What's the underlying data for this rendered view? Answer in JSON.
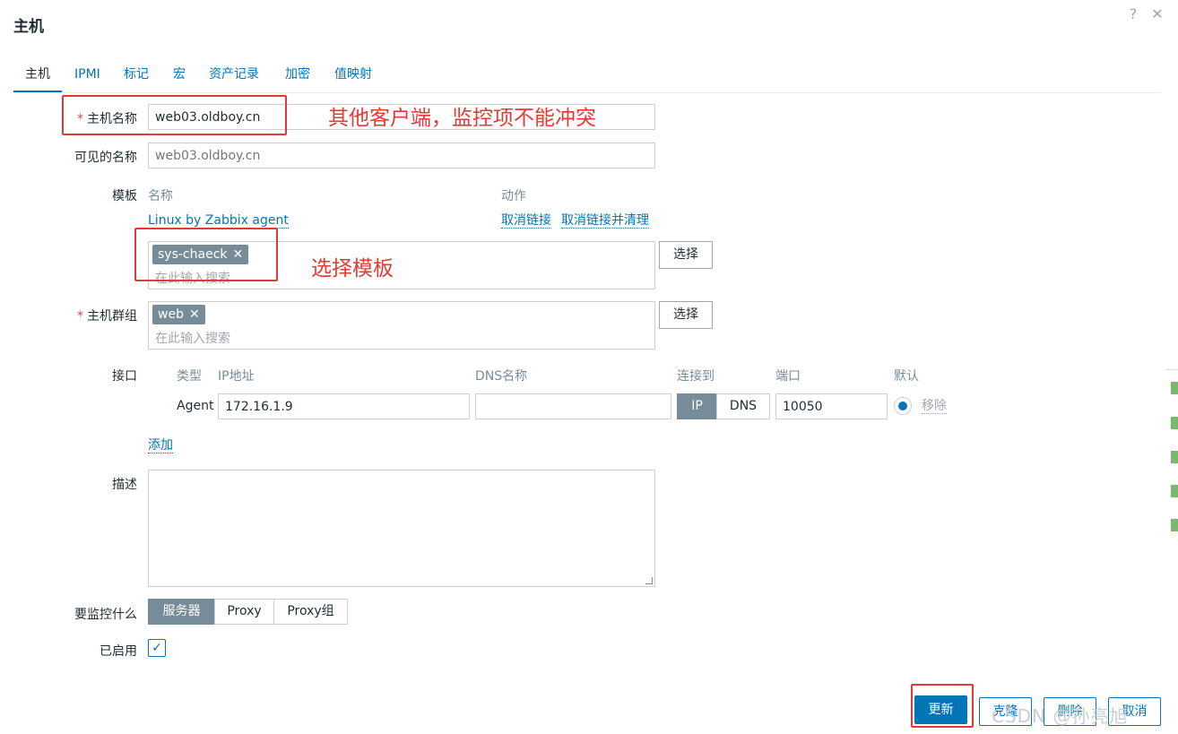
{
  "dialog": {
    "title": "主机",
    "help_glyph": "?",
    "close_glyph": "✕"
  },
  "tabs": [
    {
      "label": "主机"
    },
    {
      "label": "IPMI"
    },
    {
      "label": "标记"
    },
    {
      "label": "宏"
    },
    {
      "label": "资产记录"
    },
    {
      "label": "加密"
    },
    {
      "label": "值映射"
    }
  ],
  "host_name": {
    "label": "主机名称",
    "value": "web03.oldboy.cn"
  },
  "visible_name": {
    "label": "可见的名称",
    "placeholder": "web03.oldboy.cn"
  },
  "templates": {
    "label": "模板",
    "col_name": "名称",
    "col_action": "动作",
    "linked": "Linux by Zabbix agent",
    "unlink": "取消链接",
    "unlink_clear": "取消链接并清理",
    "chip": "sys-chaeck",
    "placeholder": "在此输入搜索",
    "select": "选择"
  },
  "host_groups": {
    "label": "主机群组",
    "chip": "web",
    "placeholder": "在此输入搜索",
    "select": "选择"
  },
  "interfaces": {
    "label": "接口",
    "col_type": "类型",
    "col_ip": "IP地址",
    "col_dns": "DNS名称",
    "col_connect": "连接到",
    "col_port": "端口",
    "col_default": "默认",
    "row": {
      "type": "Agent",
      "ip": "172.16.1.9",
      "dns": "",
      "ip_btn": "IP",
      "dns_btn": "DNS",
      "port": "10050",
      "remove": "移除"
    },
    "add": "添加"
  },
  "description": {
    "label": "描述",
    "value": ""
  },
  "monitored_by": {
    "label": "要监控什么",
    "options": [
      "服务器",
      "Proxy",
      "Proxy组"
    ]
  },
  "enabled": {
    "label": "已启用",
    "check_glyph": "✓"
  },
  "footer": {
    "update": "更新",
    "clone": "克隆",
    "delete": "删除",
    "cancel": "取消"
  },
  "annotations": {
    "host_conflict": "其他客户端，监控项不能冲突",
    "choose_template": "选择模板"
  },
  "watermark": "CSDN @孙亮旭",
  "colors": {
    "accent": "#0275b8",
    "chip": "#768d99",
    "annotation": "#e53935",
    "required": "#d64e4e"
  }
}
